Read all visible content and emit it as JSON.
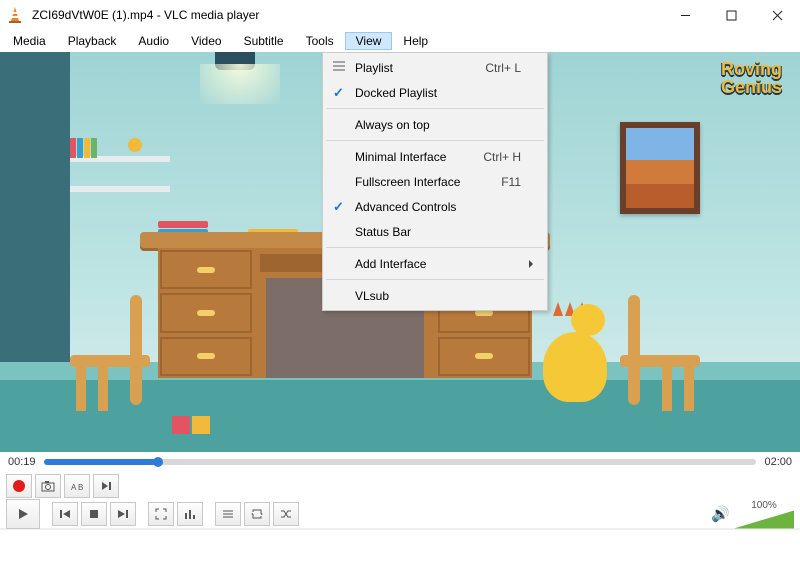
{
  "window": {
    "title": "ZCI69dVtW0E (1).mp4 - VLC media player"
  },
  "menubar": {
    "items": [
      "Media",
      "Playback",
      "Audio",
      "Video",
      "Subtitle",
      "Tools",
      "View",
      "Help"
    ],
    "active_index": 6
  },
  "view_menu": {
    "playlist": {
      "label": "Playlist",
      "shortcut": "Ctrl+ L"
    },
    "docked_playlist": {
      "label": "Docked Playlist",
      "checked": true
    },
    "always_on_top": {
      "label": "Always on top"
    },
    "minimal": {
      "label": "Minimal Interface",
      "shortcut": "Ctrl+ H"
    },
    "fullscreen": {
      "label": "Fullscreen Interface",
      "shortcut": "F11"
    },
    "advanced_controls": {
      "label": "Advanced Controls",
      "checked": true
    },
    "status_bar": {
      "label": "Status Bar"
    },
    "add_interface": {
      "label": "Add Interface"
    },
    "vlsub": {
      "label": "VLsub"
    }
  },
  "playback": {
    "elapsed": "00:19",
    "total": "02:00",
    "progress_pct": 16
  },
  "volume": {
    "label": "100%"
  },
  "content": {
    "logo_line1": "Roving",
    "logo_line2": "Genius"
  }
}
